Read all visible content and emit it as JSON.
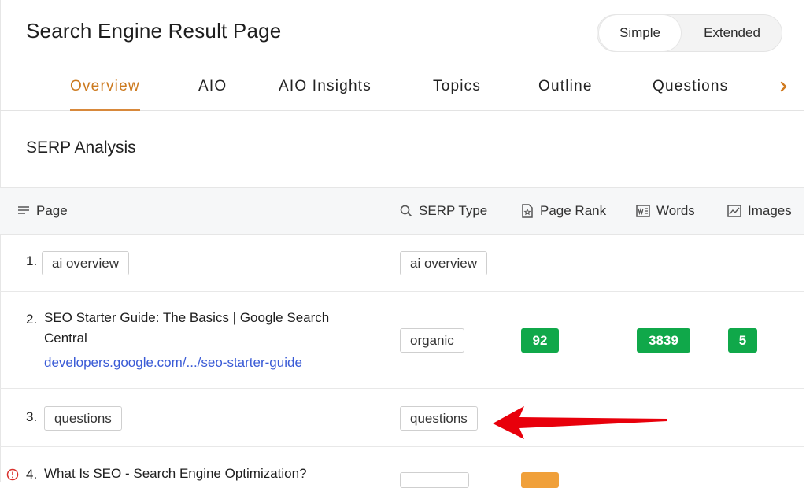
{
  "title": "Search Engine Result Page",
  "view_toggle": {
    "simple": "Simple",
    "extended": "Extended",
    "selected": "Simple"
  },
  "tabs": [
    {
      "label": "Overview",
      "active": true
    },
    {
      "label": "AIO"
    },
    {
      "label": "AIO Insights"
    },
    {
      "label": "Topics"
    },
    {
      "label": "Outline"
    },
    {
      "label": "Questions"
    }
  ],
  "section_title": "SERP Analysis",
  "table": {
    "headers": {
      "page": "Page",
      "serp_type": "SERP Type",
      "page_rank": "Page Rank",
      "words": "Words",
      "images": "Images"
    },
    "rows": [
      {
        "num": "1.",
        "page_tag": "ai overview",
        "serp_type": "ai overview"
      },
      {
        "num": "2.",
        "title_line1": "SEO Starter Guide: The Basics | Google Search",
        "title_line2": "Central",
        "link": "developers.google.com/.../seo-starter-guide",
        "serp_type": "organic",
        "page_rank": "92",
        "words": "3839",
        "images": "5"
      },
      {
        "num": "3.",
        "page_tag": "questions",
        "serp_type": "questions"
      },
      {
        "num": "4.",
        "title_line1": "What Is SEO - Search Engine Optimization?"
      }
    ]
  },
  "colors": {
    "accent": "#cc7a1f",
    "badge_green": "#10a84a",
    "badge_orange": "#f0a03a",
    "link": "#3a5bd6",
    "annotation_arrow": "#e8000b"
  }
}
